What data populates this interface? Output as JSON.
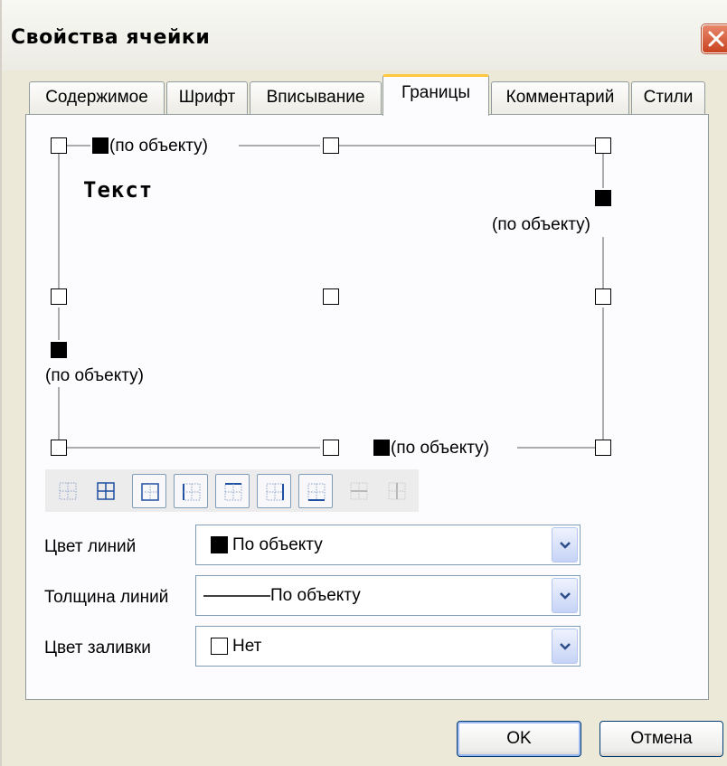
{
  "window": {
    "title": "Свойства ячейки"
  },
  "tabs": [
    {
      "label": "Содержимое",
      "active": false
    },
    {
      "label": "Шрифт",
      "active": false
    },
    {
      "label": "Вписывание",
      "active": false
    },
    {
      "label": "Границы",
      "active": true
    },
    {
      "label": "Комментарий",
      "active": false
    },
    {
      "label": "Стили",
      "active": false
    }
  ],
  "preview": {
    "sample_text": "Текст",
    "top_border_label": "(по объекту)",
    "right_border_label": "(по объекту)",
    "left_border_label": "(по объекту)",
    "bottom_border_label": "(по объекту)"
  },
  "presets": [
    {
      "icon": "border-none-icon",
      "state": "normal"
    },
    {
      "icon": "border-all-icon",
      "state": "normal"
    },
    {
      "icon": "border-outer-icon",
      "state": "raised"
    },
    {
      "icon": "border-left-icon",
      "state": "raised"
    },
    {
      "icon": "border-top-icon",
      "state": "raised"
    },
    {
      "icon": "border-right-icon",
      "state": "raised"
    },
    {
      "icon": "border-bottom-icon",
      "state": "raised"
    },
    {
      "icon": "border-inner-horizontal-icon",
      "state": "disabled"
    },
    {
      "icon": "border-inner-vertical-icon",
      "state": "disabled"
    }
  ],
  "form": {
    "line_color": {
      "label": "Цвет линий",
      "value": "По объекту",
      "swatch": "#000000"
    },
    "line_width": {
      "label": "Толщина линий",
      "value": "По объекту"
    },
    "fill_color": {
      "label": "Цвет заливки",
      "value": "Нет"
    }
  },
  "buttons": {
    "ok": "OK",
    "cancel": "Отмена"
  },
  "colors": {
    "accent_tab": "#ffc83c",
    "close_button": "#c8431f",
    "dialog_bg": "#ece9d8"
  }
}
